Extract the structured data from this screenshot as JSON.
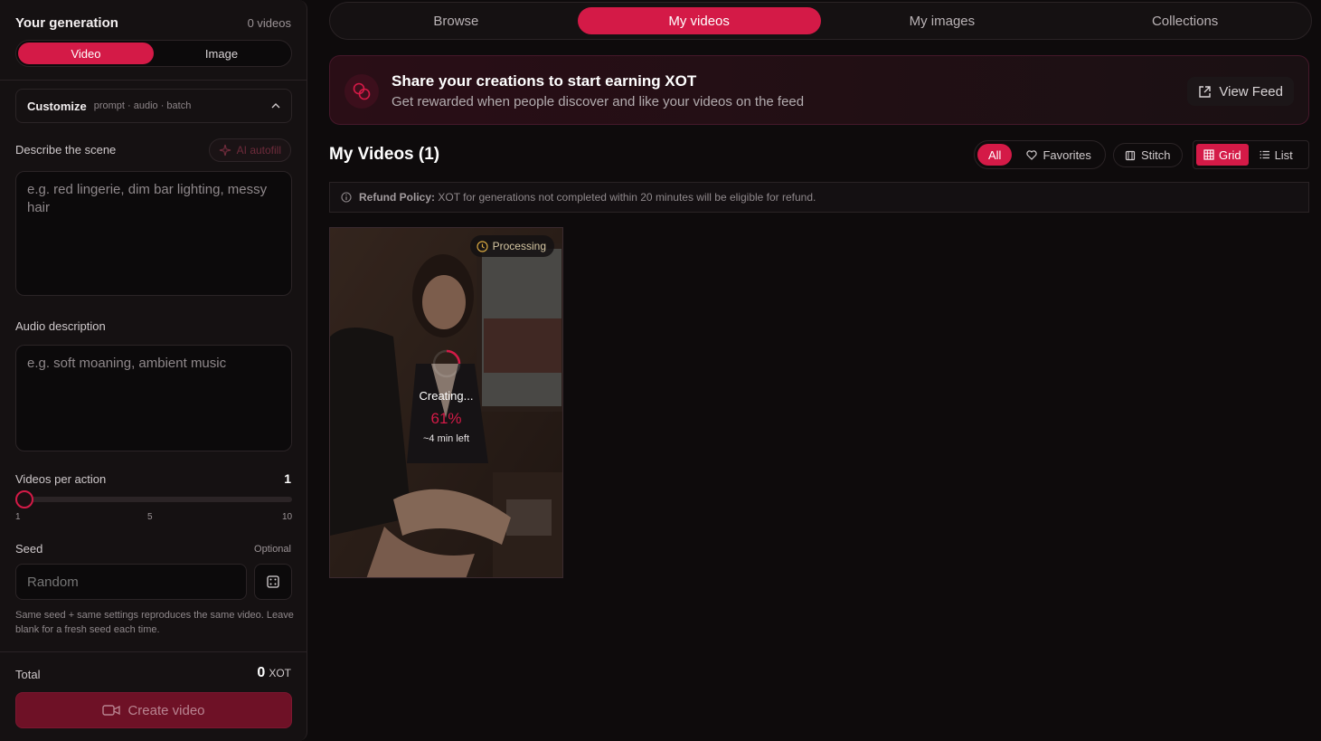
{
  "sidebar": {
    "title": "Your generation",
    "count": "0 videos",
    "modes": [
      "Video",
      "Image"
    ],
    "active_mode": "Video",
    "customize": {
      "title": "Customize",
      "subtitle": "prompt · audio · batch"
    },
    "scene": {
      "label": "Describe the scene",
      "autofill": "AI autofill",
      "placeholder": "e.g. red lingerie, dim bar lighting, messy hair"
    },
    "audio": {
      "label": "Audio description",
      "placeholder": "e.g. soft moaning, ambient music"
    },
    "videos_per_action": {
      "label": "Videos per action",
      "value": "1",
      "min_label": "1",
      "mid_label": "5",
      "max_label": "10",
      "value_fraction": 0.0
    },
    "seed": {
      "label": "Seed",
      "optional": "Optional",
      "placeholder": "Random",
      "help": "Same seed + same settings reproduces the same video. Leave blank for a fresh seed each time."
    },
    "total": {
      "label": "Total",
      "value": "0",
      "unit": "XOT"
    },
    "create_button": "Create video"
  },
  "tabs": [
    "Browse",
    "My videos",
    "My images",
    "Collections"
  ],
  "active_tab": "My videos",
  "banner": {
    "title": "Share your creations to start earning XOT",
    "subtitle": "Get rewarded when people discover and like your videos on the feed",
    "button": "View Feed"
  },
  "section": {
    "title": "My Videos (1)",
    "filters": [
      "All",
      "Favorites"
    ],
    "active_filter": "All",
    "stitch": "Stitch",
    "views": [
      "Grid",
      "List"
    ],
    "active_view": "Grid"
  },
  "refund": {
    "label": "Refund Policy:",
    "text": "XOT for generations not completed within 20 minutes will be eligible for refund."
  },
  "card": {
    "status": "Processing",
    "creating": "Creating...",
    "progress": "61%",
    "eta": "~4 min left"
  },
  "colors": {
    "accent": "#d41a47",
    "background": "#0e0b0c",
    "panel": "#151112"
  }
}
